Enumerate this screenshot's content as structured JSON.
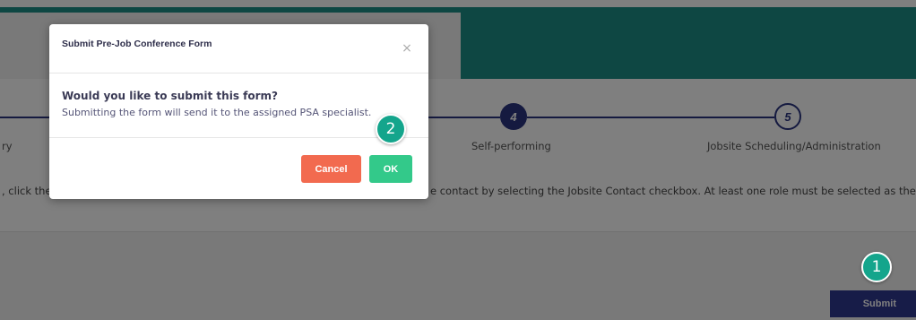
{
  "page": {
    "steps": [
      {
        "number": "4",
        "label": "Self-performing",
        "state": "active"
      },
      {
        "number": "5",
        "label": "Jobsite Scheduling/Administration",
        "state": "upcoming"
      }
    ],
    "partial_step_label": "ry",
    "instructions_left": ", click the",
    "instructions_right": "e contact by selecting the Jobsite Contact checkbox. At least one role must be selected as the",
    "submit_label": "Submit"
  },
  "modal": {
    "title": "Submit Pre-Job Conference Form",
    "close_glyph": "×",
    "question": "Would you like to submit this form?",
    "message": "Submitting the form will send it to the assigned PSA specialist.",
    "cancel_label": "Cancel",
    "ok_label": "OK"
  },
  "callouts": [
    {
      "number": "1",
      "target": "submit-button"
    },
    {
      "number": "2",
      "target": "modal-message"
    }
  ],
  "colors": {
    "header_teal": "#1d8f86",
    "step_navy": "#2a3580",
    "submit_navy": "#2f3991",
    "cancel_orange": "#f26a4f",
    "ok_green": "#33c98a",
    "callout_teal": "#14a58c"
  },
  "icons": {
    "close": "close-icon"
  }
}
